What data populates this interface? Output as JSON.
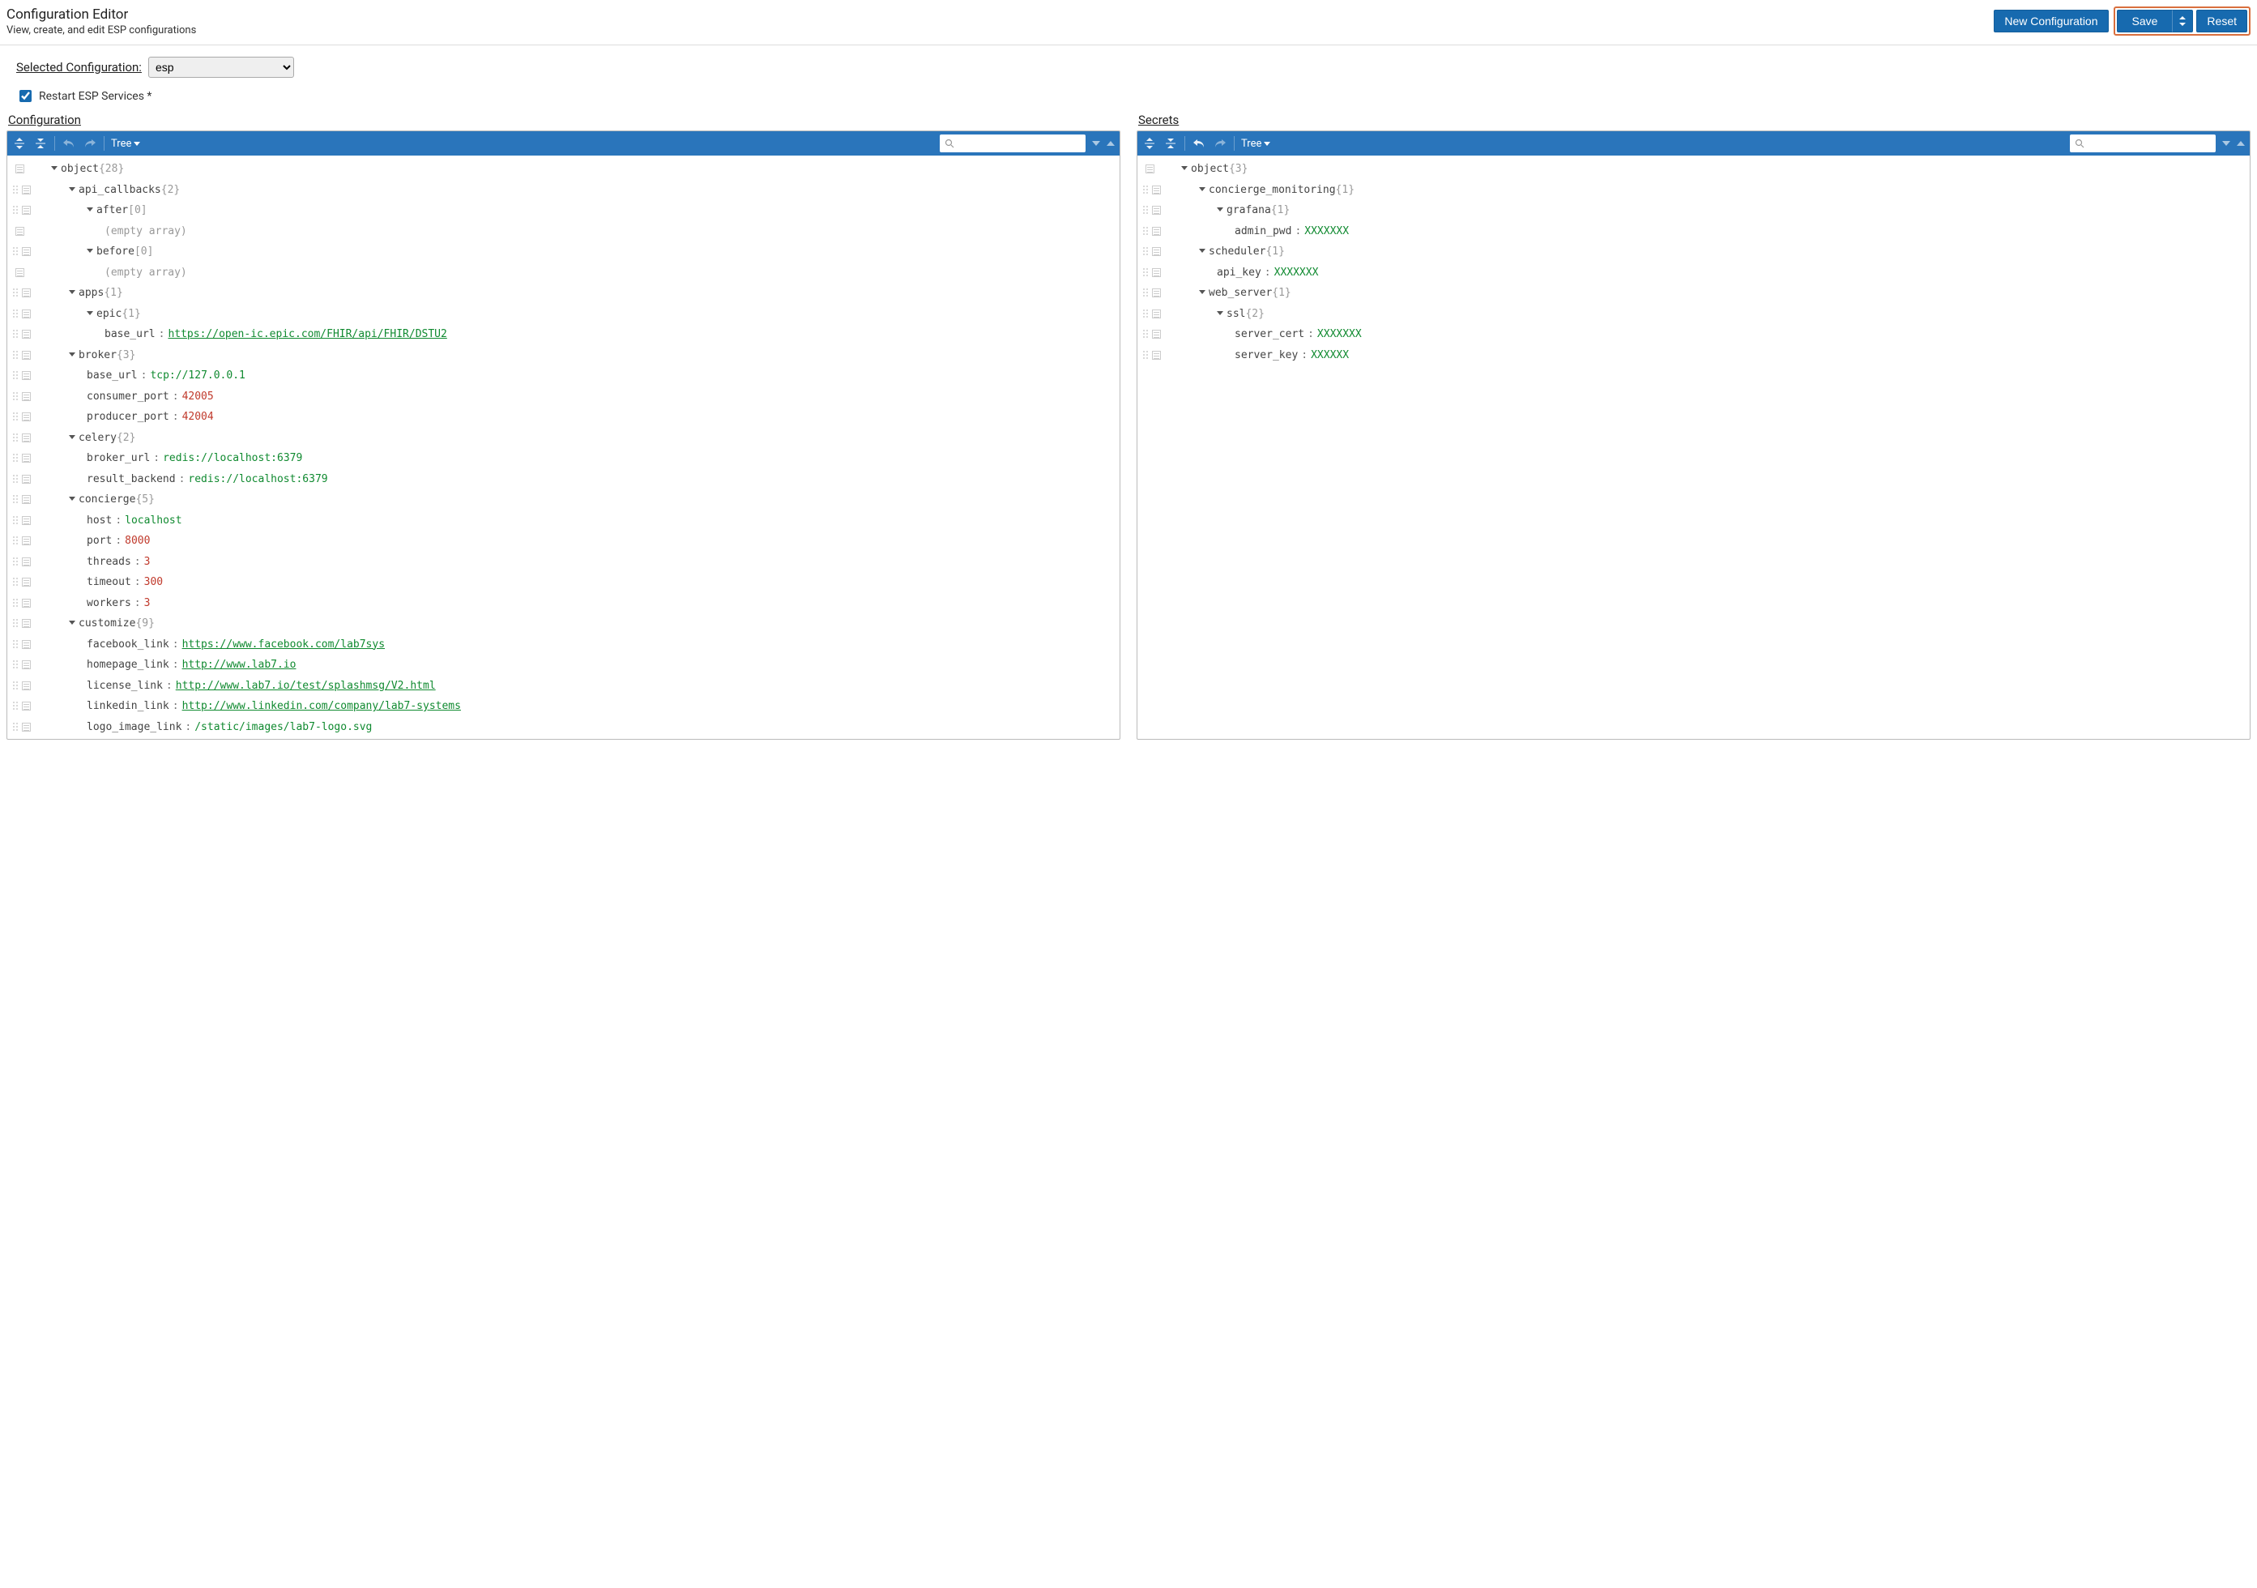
{
  "header": {
    "title": "Configuration Editor",
    "subtitle": "View, create, and edit ESP configurations",
    "new_config_label": "New Configuration",
    "save_label": "Save",
    "reset_label": "Reset"
  },
  "controls": {
    "selected_config_label": "Selected Configuration:",
    "selected_config_value": "esp",
    "restart_label": "Restart ESP Services *",
    "restart_checked": true
  },
  "toolbar": {
    "mode_label": "Tree"
  },
  "config_panel": {
    "title": "Configuration",
    "rows": [
      {
        "indent": 0,
        "caret": true,
        "key": "object",
        "meta": "{28}",
        "gutter": "menu"
      },
      {
        "indent": 1,
        "caret": true,
        "key": "api_callbacks",
        "meta": "{2}"
      },
      {
        "indent": 2,
        "caret": true,
        "key": "after",
        "meta": "[0]"
      },
      {
        "indent": 3,
        "caret": false,
        "key": "",
        "meta": "(empty array)",
        "gutter": "menu"
      },
      {
        "indent": 2,
        "caret": true,
        "key": "before",
        "meta": "[0]"
      },
      {
        "indent": 3,
        "caret": false,
        "key": "",
        "meta": "(empty array)",
        "gutter": "menu"
      },
      {
        "indent": 1,
        "caret": true,
        "key": "apps",
        "meta": "{1}"
      },
      {
        "indent": 2,
        "caret": true,
        "key": "epic",
        "meta": "{1}"
      },
      {
        "indent": 3,
        "caret": false,
        "key": "base_url",
        "value": "https://open-ic.epic.com/FHIR/api/FHIR/DSTU2",
        "vtype": "link"
      },
      {
        "indent": 1,
        "caret": true,
        "key": "broker",
        "meta": "{3}"
      },
      {
        "indent": 2,
        "caret": false,
        "key": "base_url",
        "value": "tcp://127.0.0.1",
        "vtype": "str"
      },
      {
        "indent": 2,
        "caret": false,
        "key": "consumer_port",
        "value": "42005",
        "vtype": "num"
      },
      {
        "indent": 2,
        "caret": false,
        "key": "producer_port",
        "value": "42004",
        "vtype": "num"
      },
      {
        "indent": 1,
        "caret": true,
        "key": "celery",
        "meta": "{2}"
      },
      {
        "indent": 2,
        "caret": false,
        "key": "broker_url",
        "value": "redis://localhost:6379",
        "vtype": "str"
      },
      {
        "indent": 2,
        "caret": false,
        "key": "result_backend",
        "value": "redis://localhost:6379",
        "vtype": "str"
      },
      {
        "indent": 1,
        "caret": true,
        "key": "concierge",
        "meta": "{5}"
      },
      {
        "indent": 2,
        "caret": false,
        "key": "host",
        "value": "localhost",
        "vtype": "str"
      },
      {
        "indent": 2,
        "caret": false,
        "key": "port",
        "value": "8000",
        "vtype": "num"
      },
      {
        "indent": 2,
        "caret": false,
        "key": "threads",
        "value": "3",
        "vtype": "num"
      },
      {
        "indent": 2,
        "caret": false,
        "key": "timeout",
        "value": "300",
        "vtype": "num"
      },
      {
        "indent": 2,
        "caret": false,
        "key": "workers",
        "value": "3",
        "vtype": "num"
      },
      {
        "indent": 1,
        "caret": true,
        "key": "customize",
        "meta": "{9}"
      },
      {
        "indent": 2,
        "caret": false,
        "key": "facebook_link",
        "value": "https://www.facebook.com/lab7sys",
        "vtype": "link"
      },
      {
        "indent": 2,
        "caret": false,
        "key": "homepage_link",
        "value": "http://www.lab7.io",
        "vtype": "link"
      },
      {
        "indent": 2,
        "caret": false,
        "key": "license_link",
        "value": "http://www.lab7.io/test/splashmsg/V2.html",
        "vtype": "link"
      },
      {
        "indent": 2,
        "caret": false,
        "key": "linkedin_link",
        "value": "http://www.linkedin.com/company/lab7-systems",
        "vtype": "link"
      },
      {
        "indent": 2,
        "caret": false,
        "key": "logo_image_link",
        "value": "/static/images/lab7-logo.svg",
        "vtype": "str"
      }
    ]
  },
  "secrets_panel": {
    "title": "Secrets",
    "rows": [
      {
        "indent": 0,
        "caret": true,
        "key": "object",
        "meta": "{3}",
        "gutter": "menu"
      },
      {
        "indent": 1,
        "caret": true,
        "key": "concierge_monitoring",
        "meta": "{1}"
      },
      {
        "indent": 2,
        "caret": true,
        "key": "grafana",
        "meta": "{1}"
      },
      {
        "indent": 3,
        "caret": false,
        "key": "admin_pwd",
        "value": "XXXXXXX",
        "vtype": "mask"
      },
      {
        "indent": 1,
        "caret": true,
        "key": "scheduler",
        "meta": "{1}"
      },
      {
        "indent": 2,
        "caret": false,
        "key": "api_key",
        "value": "XXXXXXX",
        "vtype": "mask"
      },
      {
        "indent": 1,
        "caret": true,
        "key": "web_server",
        "meta": "{1}"
      },
      {
        "indent": 2,
        "caret": true,
        "key": "ssl",
        "meta": "{2}"
      },
      {
        "indent": 3,
        "caret": false,
        "key": "server_cert",
        "value": "XXXXXXX",
        "vtype": "mask"
      },
      {
        "indent": 3,
        "caret": false,
        "key": "server_key",
        "value": "XXXXXX",
        "vtype": "mask"
      }
    ]
  }
}
